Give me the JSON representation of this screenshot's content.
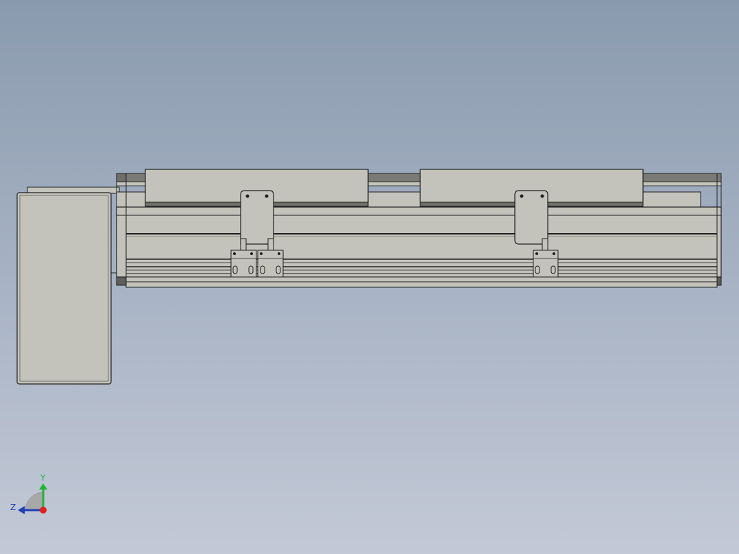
{
  "viewport": {
    "background_top": "#8a9aae",
    "background_bottom": "#c3c9d6",
    "part_fill": "#c3c3bb",
    "edge_color": "#1e1e1e",
    "dark_fill": "#6e6e6b"
  },
  "triad": {
    "y_label": "Y",
    "z_label": "Z",
    "y_color": "#1fb531",
    "z_color": "#1d3fb3",
    "x_color": "#e0201c"
  }
}
